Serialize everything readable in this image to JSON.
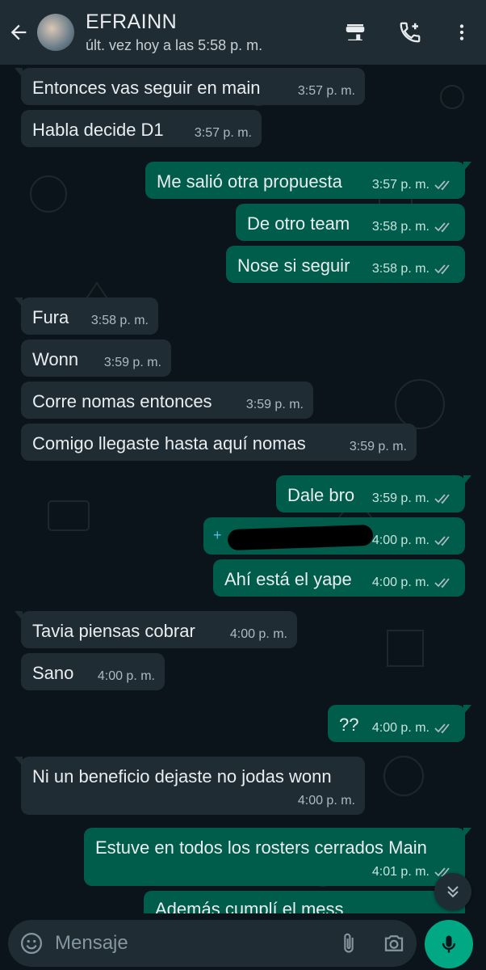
{
  "header": {
    "contact_name": "EFRAINN",
    "last_seen": "últ. vez hoy a las 5:58 p. m.",
    "icons": [
      "back-arrow-icon",
      "shop-icon",
      "add-call-icon",
      "more-vert-icon"
    ]
  },
  "messages": [
    {
      "dir": "in",
      "text": "Entonces vas seguir en main",
      "time": "3:57 p. m."
    },
    {
      "dir": "in",
      "text": "Habla decide D1",
      "time": "3:57 p. m."
    },
    {
      "dir": "out",
      "text": "Me salió otra propuesta",
      "time": "3:57 p. m."
    },
    {
      "dir": "out",
      "text": "De otro team",
      "time": "3:58 p. m."
    },
    {
      "dir": "out",
      "text": "Nose si seguir",
      "time": "3:58 p. m."
    },
    {
      "dir": "in",
      "text": "Fura",
      "time": "3:58 p. m."
    },
    {
      "dir": "in",
      "text": "Wonn",
      "time": "3:59 p. m."
    },
    {
      "dir": "in",
      "text": "Corre nomas entonces",
      "time": "3:59 p. m."
    },
    {
      "dir": "in",
      "text": "Comigo llegaste hasta aquí nomas",
      "time": "3:59 p. m."
    },
    {
      "dir": "out",
      "text": "Dale bro",
      "time": "3:59 p. m."
    },
    {
      "dir": "out",
      "text": "",
      "time": "4:00 p. m.",
      "redacted": true
    },
    {
      "dir": "out",
      "text": "Ahí está el yape",
      "time": "4:00 p. m."
    },
    {
      "dir": "in",
      "text": "Tavia piensas cobrar",
      "time": "4:00 p. m."
    },
    {
      "dir": "in",
      "text": "Sano",
      "time": "4:00 p. m."
    },
    {
      "dir": "out",
      "text": "??",
      "time": "4:00 p. m."
    },
    {
      "dir": "in",
      "text": "Ni un beneficio dejaste no jodas wonn",
      "time": "4:00 p. m."
    },
    {
      "dir": "out",
      "text": "Estuve en todos los rosters cerrados Main",
      "time": "4:01 p. m."
    },
    {
      "dir": "out",
      "text": "Además cumplí el mess",
      "time": ""
    }
  ],
  "input": {
    "placeholder": "Mensaje"
  },
  "colors": {
    "header_bg": "#1f2c34",
    "chat_bg": "#0b141a",
    "incoming_bubble": "#1f2c34",
    "outgoing_bubble": "#005c4b",
    "mic_button": "#00a884"
  }
}
